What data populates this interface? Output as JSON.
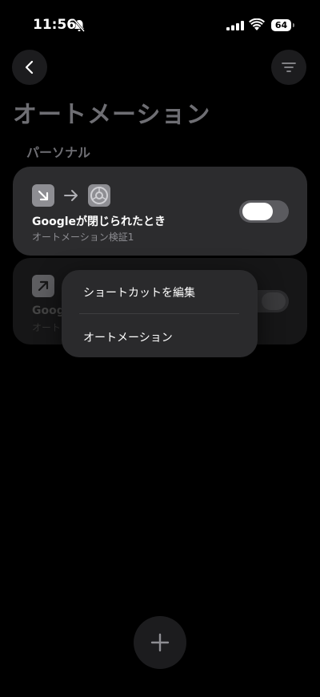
{
  "status_bar": {
    "time": "11:56",
    "battery": "64",
    "icons": [
      "bell-slash-icon",
      "cellular-signal-icon",
      "wifi-icon",
      "battery-icon"
    ]
  },
  "nav": {
    "back_icon": "chevron-left-icon",
    "filter_icon": "filter-lines-icon"
  },
  "page": {
    "title": "オートメーション",
    "section": "パーソナル"
  },
  "automations": [
    {
      "title": "Googleが閉じられたとき",
      "subtitle": "オートメーション検証1",
      "trigger_icon": "arrow-down-right-icon",
      "action_icon": "settings-icon",
      "enabled": true
    },
    {
      "title": "Googl",
      "subtitle": "オート",
      "trigger_icon": "arrow-up-right-icon",
      "enabled": false
    }
  ],
  "context_menu": {
    "items": [
      "ショートカットを編集",
      "オートメーション"
    ]
  },
  "add_button": {
    "icon": "plus-icon"
  },
  "colors": {
    "background": "#000000",
    "card": "#2c2c2e",
    "menu": "#2a2a2c",
    "toggle_track": "#5b5b5f",
    "secondary_text": "#8e8e93"
  }
}
